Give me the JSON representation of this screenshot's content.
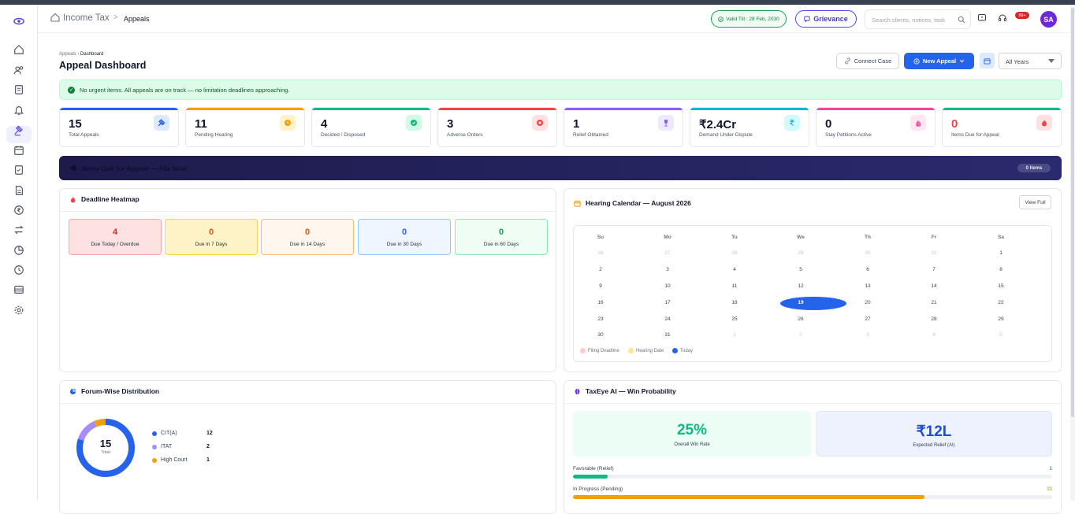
{
  "header": {
    "breadcrumb_root": "Income Tax",
    "breadcrumb_sep": ">",
    "breadcrumb_current": "Appeals",
    "valid_till": "Valid Till : 28 Feb, 2030",
    "grievance_label": "Grievance",
    "search_placeholder": "Search clients, notices, task",
    "notification_badge": "99+",
    "avatar_initials": "SA"
  },
  "sidebar": {
    "icons": [
      "eye-logo-icon",
      "home-icon",
      "users-icon",
      "document-icon",
      "bell-icon",
      "gavel-icon",
      "calendar-icon",
      "checklist-icon",
      "file-icon",
      "rupee-circle-icon",
      "transfer-icon",
      "pie-icon",
      "clock-icon",
      "table-icon",
      "settings-icon"
    ],
    "active_index": 5
  },
  "page": {
    "crumb_parent": "Appeals",
    "crumb_sep": "›",
    "crumb_current": "Dashboard",
    "title": "Appeal Dashboard",
    "connect_case_label": "Connect Case",
    "new_appeal_label": "New Appeal",
    "years_select": "All Years"
  },
  "alert": {
    "text": "No urgent items. All appeals are on track — no limitation deadlines approaching."
  },
  "stats": [
    {
      "value": "15",
      "label": "Total Appeals",
      "color": "#2563eb",
      "icon_bg": "#dbeafe",
      "icon": "gavel-icon"
    },
    {
      "value": "11",
      "label": "Pending Hearing",
      "color": "#f59e0b",
      "icon_bg": "#fef3c7",
      "icon": "clock-icon"
    },
    {
      "value": "4",
      "label": "Decided / Disposed",
      "color": "#10b981",
      "icon_bg": "#d1fae5",
      "icon": "check-circle-icon"
    },
    {
      "value": "3",
      "label": "Adverse Orders",
      "color": "#ef4444",
      "icon_bg": "#fee2e2",
      "icon": "x-circle-icon"
    },
    {
      "value": "1",
      "label": "Relief Obtained",
      "color": "#8b5cf6",
      "icon_bg": "#ede9fe",
      "icon": "trophy-icon"
    },
    {
      "value": "₹2.4Cr",
      "label": "Demand Under Dispute",
      "color": "#06b6d4",
      "icon_bg": "#cffafe",
      "icon": "rupee-icon"
    },
    {
      "value": "0",
      "label": "Stay Petitions Active",
      "color": "#ec4899",
      "icon_bg": "#fce7f3",
      "icon": "hand-icon"
    },
    {
      "value": "0",
      "label": "Items Due for Appeal",
      "color": "#10b981",
      "icon_bg": "#fee2e2",
      "icon": "fire-icon",
      "value_color": "#ef4444"
    }
  ],
  "banner": {
    "title": "Items Due for Appeal — File Now",
    "badge": "0 Items"
  },
  "heatmap": {
    "title": "Deadline Heatmap",
    "cells": [
      {
        "value": "4",
        "label": "Due Today / Overdue",
        "color": "#dc2626",
        "bg": "#fee2e2",
        "border": "#fca5a5"
      },
      {
        "value": "0",
        "label": "Due in 7 Days",
        "color": "#ea580c",
        "bg": "#fef3c7",
        "border": "#fcd34d"
      },
      {
        "value": "0",
        "label": "Due in 14 Days",
        "color": "#ea580c",
        "bg": "#fff7ed",
        "border": "#fdba74"
      },
      {
        "value": "0",
        "label": "Due in 30 Days",
        "color": "#2563eb",
        "bg": "#eff6ff",
        "border": "#93c5fd"
      },
      {
        "value": "0",
        "label": "Due in 60 Days",
        "color": "#16a34a",
        "bg": "#f0fdf4",
        "border": "#86efac"
      }
    ]
  },
  "calendar": {
    "title": "Hearing Calendar — August 2026",
    "view_full": "View Full",
    "weekdays": [
      "Su",
      "Mo",
      "Tu",
      "We",
      "Th",
      "Fr",
      "Sa"
    ],
    "weeks": [
      [
        "26",
        "27",
        "28",
        "29",
        "30",
        "31",
        "1"
      ],
      [
        "2",
        "3",
        "4",
        "5",
        "6",
        "7",
        "8"
      ],
      [
        "9",
        "10",
        "11",
        "12",
        "13",
        "14",
        "15"
      ],
      [
        "16",
        "17",
        "18",
        "19",
        "20",
        "21",
        "22"
      ],
      [
        "23",
        "24",
        "25",
        "26",
        "27",
        "28",
        "29"
      ],
      [
        "30",
        "31",
        "1",
        "2",
        "3",
        "4",
        "5"
      ]
    ],
    "today": "19",
    "legend": [
      {
        "label": "Filing Deadline",
        "color": "#fecaca"
      },
      {
        "label": "Hearing Date",
        "color": "#fde68a"
      },
      {
        "label": "Today",
        "color": "#2563eb"
      }
    ]
  },
  "forum": {
    "title": "Forum-Wise Distribution",
    "total": "15",
    "total_label": "Total",
    "items": [
      {
        "label": "CIT(A)",
        "value": 12,
        "color": "#2563eb"
      },
      {
        "label": "ITAT",
        "value": 2,
        "color": "#a78bfa"
      },
      {
        "label": "High Court",
        "value": 1,
        "color": "#f59e0b"
      }
    ]
  },
  "win": {
    "title": "TaxEye AI — Win Probability",
    "rate": "25%",
    "rate_label": "Overall Win Rate",
    "relief": "₹12L",
    "relief_label": "Expected Relief (AI)",
    "bars": [
      {
        "label": "Favorable (Relief)",
        "value": "1",
        "fraction": 0.073,
        "color": "#10b981"
      },
      {
        "label": "In Progress (Pending)",
        "value": "11",
        "fraction": 0.733,
        "color": "#f59e0b"
      }
    ]
  }
}
